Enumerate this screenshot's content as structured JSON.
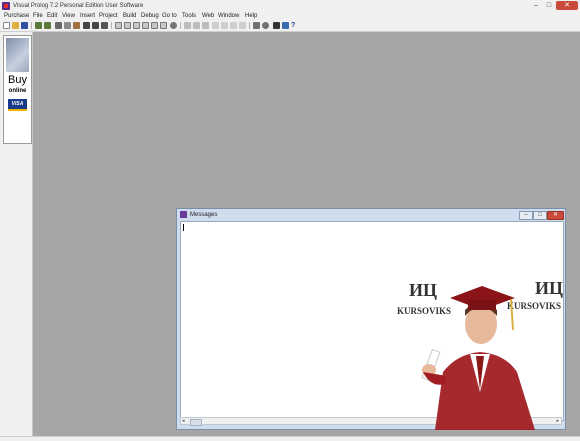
{
  "window": {
    "title": "Visual Prolog 7.2 Personal Edition User Software",
    "controls": {
      "minimize": "–",
      "maximize": "□",
      "close": "✕"
    }
  },
  "menu": [
    "Purchase",
    "File",
    "Edit",
    "View",
    "Insert",
    "Project",
    "Build",
    "Debug",
    "Go to",
    "Tools",
    "Web",
    "Window",
    "Help"
  ],
  "toolbar_icons": [
    "new-file-icon",
    "open-folder-icon",
    "save-icon",
    "undo-icon",
    "redo-icon",
    "cut-icon",
    "copy-icon",
    "paste-icon",
    "find-icon",
    "replace-icon",
    "format-icon",
    "window-icon",
    "panel-icon",
    "panel-icon",
    "panel-icon",
    "panel-icon",
    "panel-icon",
    "zoom-icon",
    "run-icon",
    "pause-icon",
    "stop-icon",
    "step-into-icon",
    "step-over-icon",
    "step-out-icon",
    "breakpoint-icon",
    "tool-icon",
    "gear-icon",
    "cube-icon",
    "info-icon",
    "help-icon"
  ],
  "sidebar_ad": {
    "buy": "Buy",
    "online": "online",
    "card": "VISA"
  },
  "messages_window": {
    "title": "Messages",
    "controls": {
      "minimize": "–",
      "maximize": "□",
      "close": "✕"
    }
  },
  "watermark": {
    "left_logo": "ИЦ",
    "left_text": "KURSOVIKS",
    "right_logo": "ИЦ",
    "right_text": "KURSOVIKS"
  },
  "colors": {
    "workspace": "#a6a6a6",
    "chrome": "#f0f0f0",
    "messages_frame": "#cfdced"
  }
}
